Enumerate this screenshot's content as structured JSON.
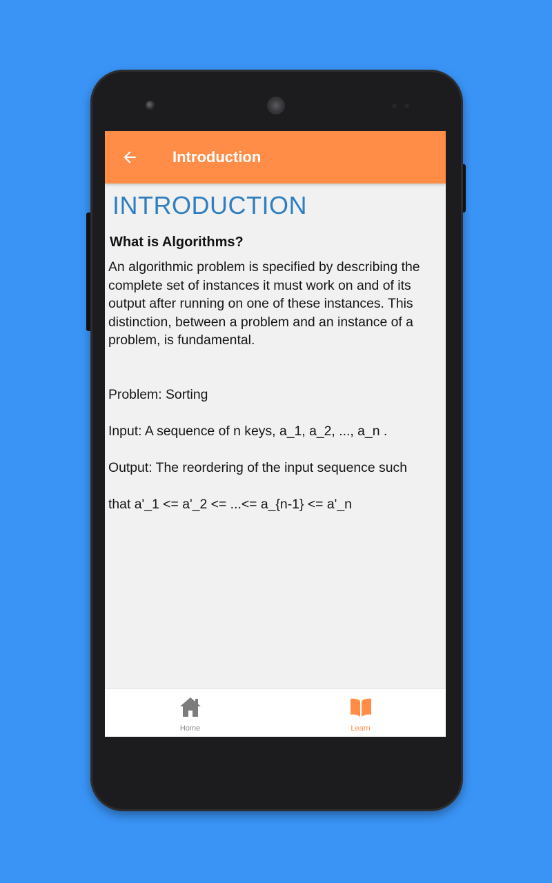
{
  "appbar": {
    "title": "Introduction",
    "back_icon": "arrow-left-icon"
  },
  "content": {
    "heading": "INTRODUCTION",
    "question": "What is Algorithms?",
    "paragraph1": "An algorithmic problem is specified by describing the complete set of instances it must work on and of its output after running on one of these instances. This distinction, between a problem and an instance of a problem, is fundamental.",
    "problem_lines": [
      "Problem: Sorting",
      "Input: A sequence of n keys, a_1, a_2, ..., a_n .",
      "Output: The reordering of the input sequence such",
      "that a'_1 <= a'_2 <= ...<= a_{n-1} <= a'_n"
    ]
  },
  "bottom_nav": {
    "items": [
      {
        "label": "Home",
        "icon": "home-icon",
        "active": false
      },
      {
        "label": "Learn",
        "icon": "book-icon",
        "active": true
      }
    ]
  },
  "colors": {
    "background": "#3a94f6",
    "appbar": "#ff8c47",
    "heading": "#2f7fc0",
    "inactive_nav": "#8a8a8a",
    "active_nav": "#ff8c47"
  }
}
